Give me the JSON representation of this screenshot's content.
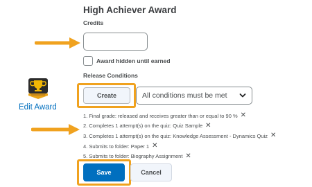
{
  "award": {
    "title": "High Achiever Award",
    "badge_icon": "trophy-badge-icon",
    "edit_link": "Edit Award"
  },
  "form": {
    "credits_label": "Credits",
    "credits_value": "",
    "hidden_checkbox_label": "Award hidden until earned",
    "hidden_checked": false,
    "release_conditions_label": "Release Conditions",
    "create_button": "Create",
    "conditions_select": "All conditions must be met",
    "conditions": [
      "1. Final grade: released and receives greater than or equal to 90 %",
      "2. Completes 1 attempt(s) on the quiz: Quiz Sample",
      "3. Completes 1 attempt(s) on the quiz: Knowledge Assessment - Dynamics Quiz",
      "4. Submits to folder: Paper 1",
      "5. Submits to folder: Biography Assignment"
    ],
    "remove_glyph": "✕",
    "save_button": "Save",
    "cancel_button": "Cancel"
  },
  "colors": {
    "highlight": "#f0a21f",
    "primary": "#006fbf",
    "arrow": "#f0a21f"
  }
}
